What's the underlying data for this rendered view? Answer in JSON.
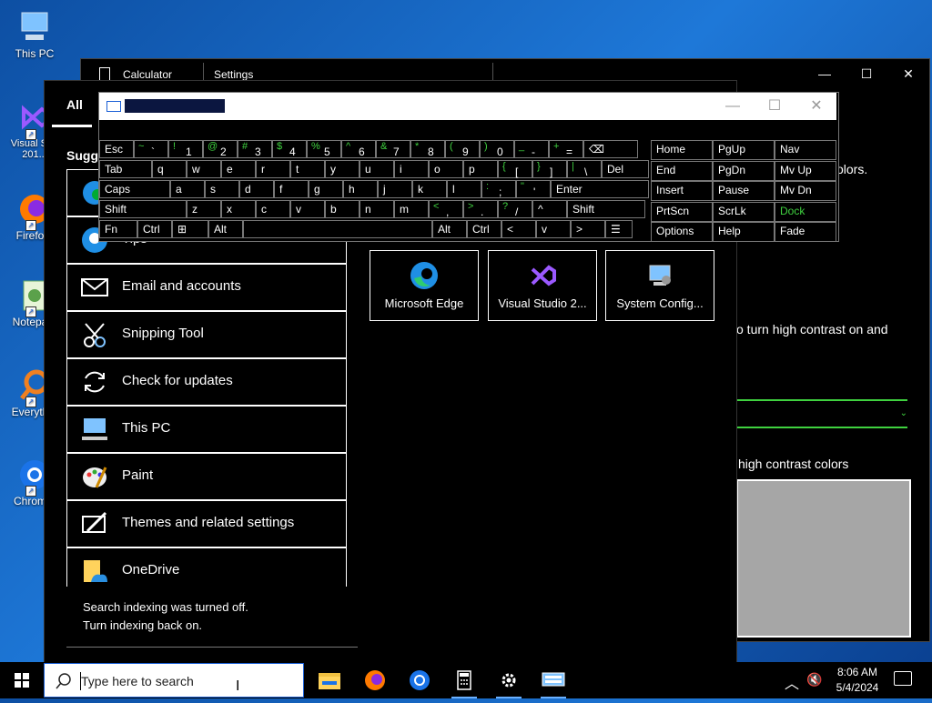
{
  "desktop": {
    "icons": [
      {
        "label": "This PC"
      },
      {
        "label": "Visual St... 201..."
      },
      {
        "label": "Firefo..."
      },
      {
        "label": "Notepa..."
      },
      {
        "label": "Everyth..."
      },
      {
        "label": "Chrom..."
      }
    ]
  },
  "settings_window": {
    "calc_title": "Calculator",
    "title": "Settings",
    "minimize": "—",
    "maximize": "☐",
    "close": "✕",
    "text_colors": "olors.",
    "text_contrast": "o turn high contrast on and",
    "text_hc_colors": "high contrast colors"
  },
  "start_menu": {
    "tab_all": "All",
    "suggested": "Sugge",
    "items": [
      {
        "label": "Tips"
      },
      {
        "label": "Email and accounts"
      },
      {
        "label": "Snipping Tool"
      },
      {
        "label": "Check for updates"
      },
      {
        "label": "This PC"
      },
      {
        "label": "Paint"
      },
      {
        "label": "Themes and related settings"
      },
      {
        "label": "OneDrive"
      }
    ],
    "tiles": [
      {
        "label": "Microsoft Edge"
      },
      {
        "label": "Visual Studio 2..."
      },
      {
        "label": "System Config..."
      }
    ],
    "index_msg_1": "Search indexing was turned off.",
    "index_msg_2": "Turn indexing back on."
  },
  "osk": {
    "minimize": "—",
    "maximize": "☐",
    "close": "✕",
    "rows": {
      "r1": [
        {
          "m": "Esc"
        },
        {
          "s": "~",
          "b": "`"
        },
        {
          "s": "!",
          "b": "1"
        },
        {
          "s": "@",
          "b": "2"
        },
        {
          "s": "#",
          "b": "3"
        },
        {
          "s": "$",
          "b": "4"
        },
        {
          "s": "%",
          "b": "5"
        },
        {
          "s": "^",
          "b": "6"
        },
        {
          "s": "&",
          "b": "7"
        },
        {
          "s": "*",
          "b": "8"
        },
        {
          "s": "(",
          "b": "9"
        },
        {
          "s": ")",
          "b": "0"
        },
        {
          "s": "_",
          "b": "-"
        },
        {
          "s": "+",
          "b": "="
        },
        {
          "m": "⌫"
        }
      ],
      "r2": [
        {
          "m": "Tab"
        },
        {
          "m": "q"
        },
        {
          "m": "w"
        },
        {
          "m": "e"
        },
        {
          "m": "r"
        },
        {
          "m": "t"
        },
        {
          "m": "y"
        },
        {
          "m": "u"
        },
        {
          "m": "i"
        },
        {
          "m": "o"
        },
        {
          "m": "p"
        },
        {
          "s": "{",
          "b": "["
        },
        {
          "s": "}",
          "b": "]"
        },
        {
          "s": "|",
          "b": "\\"
        },
        {
          "m": "Del"
        }
      ],
      "r3": [
        {
          "m": "Caps"
        },
        {
          "m": "a"
        },
        {
          "m": "s"
        },
        {
          "m": "d"
        },
        {
          "m": "f"
        },
        {
          "m": "g"
        },
        {
          "m": "h"
        },
        {
          "m": "j"
        },
        {
          "m": "k"
        },
        {
          "m": "l"
        },
        {
          "s": ":",
          "b": ";"
        },
        {
          "s": "\"",
          "b": "'"
        },
        {
          "m": "Enter"
        }
      ],
      "r4": [
        {
          "m": "Shift"
        },
        {
          "m": "z"
        },
        {
          "m": "x"
        },
        {
          "m": "c"
        },
        {
          "m": "v"
        },
        {
          "m": "b"
        },
        {
          "m": "n"
        },
        {
          "m": "m"
        },
        {
          "s": "<",
          "b": ","
        },
        {
          "s": ">",
          "b": "."
        },
        {
          "s": "?",
          "b": "/"
        },
        {
          "m": "^"
        },
        {
          "m": "Shift"
        }
      ],
      "r5": [
        {
          "m": "Fn"
        },
        {
          "m": "Ctrl"
        },
        {
          "m": "⊞"
        },
        {
          "m": "Alt"
        },
        {
          "m": ""
        },
        {
          "m": "Alt"
        },
        {
          "m": "Ctrl"
        },
        {
          "m": "<"
        },
        {
          "m": "v"
        },
        {
          "m": ">"
        },
        {
          "m": "☰"
        }
      ]
    },
    "nav": [
      [
        "Home",
        "PgUp",
        "Nav"
      ],
      [
        "End",
        "PgDn",
        "Mv Up"
      ],
      [
        "Insert",
        "Pause",
        "Mv Dn"
      ],
      [
        "PrtScn",
        "ScrLk",
        "Dock"
      ],
      [
        "Options",
        "Help",
        "Fade"
      ]
    ]
  },
  "taskbar": {
    "search_placeholder": "Type here to search",
    "time": "8:06 AM",
    "date": "5/4/2024"
  }
}
